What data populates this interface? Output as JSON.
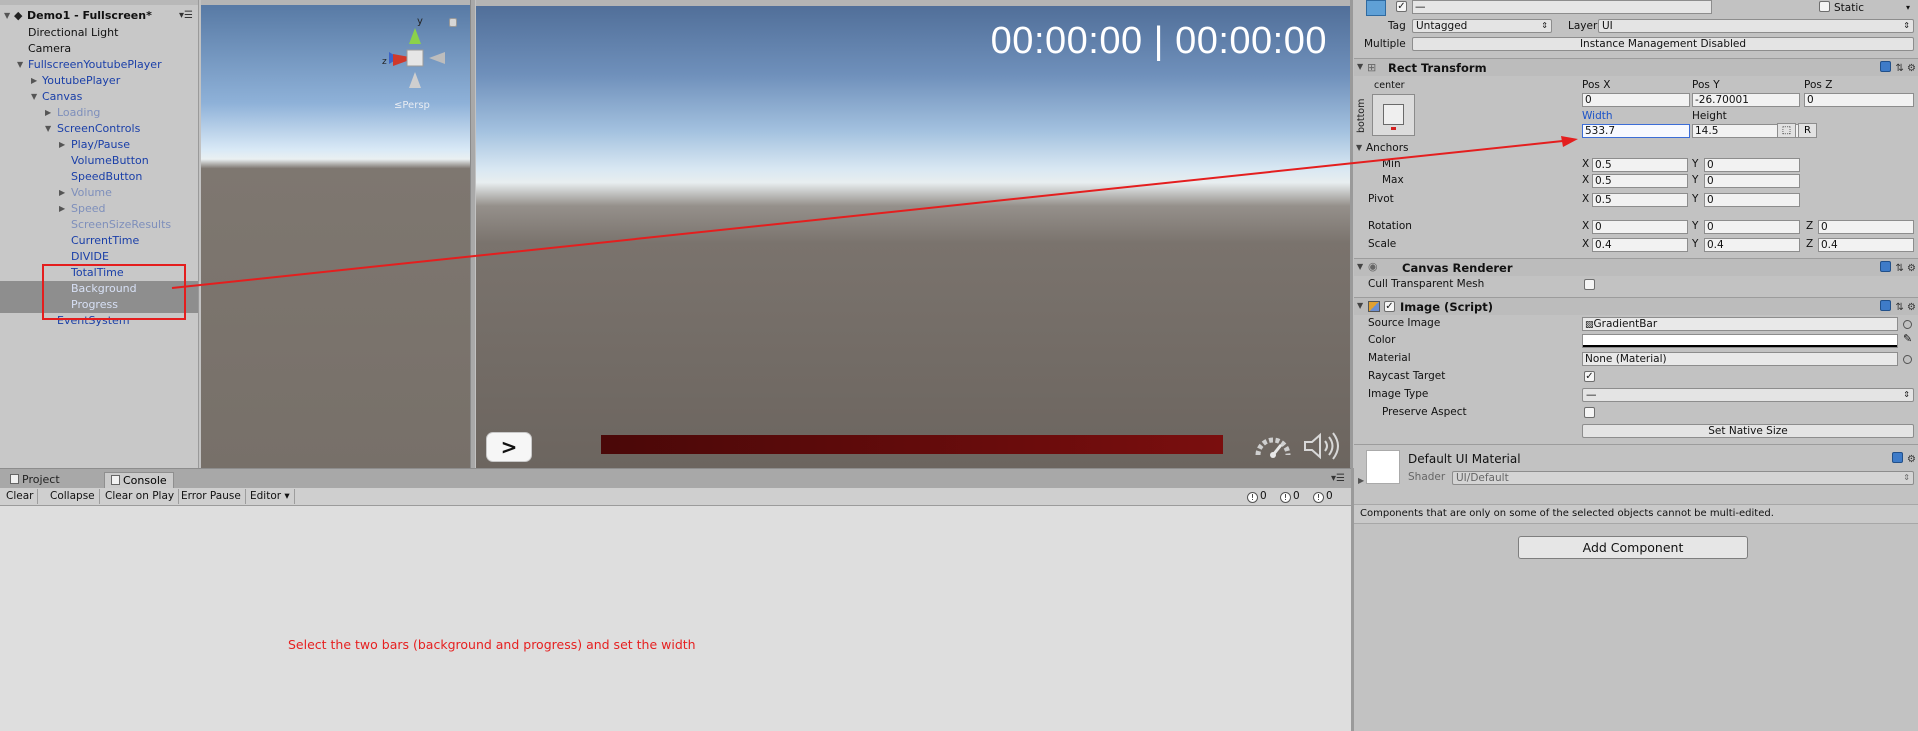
{
  "hierarchy": {
    "scene_name": "Demo1 - Fullscreen*",
    "items": [
      {
        "label": "Directional Light"
      },
      {
        "label": "Camera"
      },
      {
        "label": "FullscreenYoutubePlayer"
      },
      {
        "label": "YoutubePlayer"
      },
      {
        "label": "Canvas"
      },
      {
        "label": "Loading"
      },
      {
        "label": "ScreenControls"
      },
      {
        "label": "Play/Pause"
      },
      {
        "label": "VolumeButton"
      },
      {
        "label": "SpeedButton"
      },
      {
        "label": "Volume"
      },
      {
        "label": "Speed"
      },
      {
        "label": "ScreenSizeResults"
      },
      {
        "label": "CurrentTime"
      },
      {
        "label": "DIVIDE"
      },
      {
        "label": "TotalTime"
      },
      {
        "label": "Background"
      },
      {
        "label": "Progress"
      },
      {
        "label": "EventSystem"
      }
    ]
  },
  "scene_view": {
    "persp_label": "≤Persp",
    "gizmo_y": "y",
    "gizmo_z": "z"
  },
  "game_view": {
    "time_display": "00:00:00 | 00:00:00",
    "play_button": ">",
    "progress_fraction": 1.0
  },
  "console": {
    "tabs": [
      "Project",
      "Console"
    ],
    "active_tab": "Console",
    "toolbar": {
      "clear": "Clear",
      "collapse": "Collapse",
      "clear_on_play": "Clear on Play",
      "error_pause": "Error Pause",
      "editor": "Editor"
    },
    "counts": {
      "info": "0",
      "warn": "0",
      "error": "0"
    },
    "note": "Select the two bars (background and progress) and set the width"
  },
  "inspector": {
    "tag_label": "Tag",
    "tag_value": "Untagged",
    "layer_label": "Layer",
    "layer_value": "UI",
    "static_label": "Static",
    "multiple_label": "Multiple",
    "instance_mgmt": "Instance Management Disabled",
    "rect_transform": {
      "title": "Rect Transform",
      "anchor_preset_h": "center",
      "anchor_preset_v": "bottom",
      "pos_x_label": "Pos X",
      "pos_y_label": "Pos Y",
      "pos_z_label": "Pos Z",
      "pos_x": "0",
      "pos_y": "-26.70001",
      "pos_z": "0",
      "width_label": "Width",
      "height_label": "Height",
      "width": "533.7",
      "height": "14.5",
      "anchors_label": "Anchors",
      "min_label": "Min",
      "max_label": "Max",
      "min_x": "0.5",
      "min_y": "0",
      "max_x": "0.5",
      "max_y": "0",
      "pivot_label": "Pivot",
      "pivot_x": "0.5",
      "pivot_y": "0",
      "rotation_label": "Rotation",
      "rot_x": "0",
      "rot_y": "0",
      "rot_z": "0",
      "scale_label": "Scale",
      "scale_x": "0.4",
      "scale_y": "0.4",
      "scale_z": "0.4",
      "raw_btn": "R"
    },
    "canvas_renderer": {
      "title": "Canvas Renderer",
      "cull_label": "Cull Transparent Mesh"
    },
    "image_script": {
      "title": "Image (Script)",
      "source_image_label": "Source Image",
      "source_image": "GradientBar",
      "color_label": "Color",
      "material_label": "Material",
      "material": "None (Material)",
      "raycast_label": "Raycast Target",
      "image_type_label": "Image Type",
      "image_type": "—",
      "preserve_label": "Preserve Aspect",
      "set_native": "Set Native Size"
    },
    "material_block": {
      "title": "Default UI Material",
      "shader_label": "Shader",
      "shader": "UI/Default"
    },
    "multi_note": "Components that are only on some of the selected objects cannot be multi-edited.",
    "add_component": "Add Component"
  },
  "colors": {
    "annotation_red": "#e41e1e",
    "progress_bar": "#5a0a0a",
    "selection_field": "#3c6dd6"
  }
}
